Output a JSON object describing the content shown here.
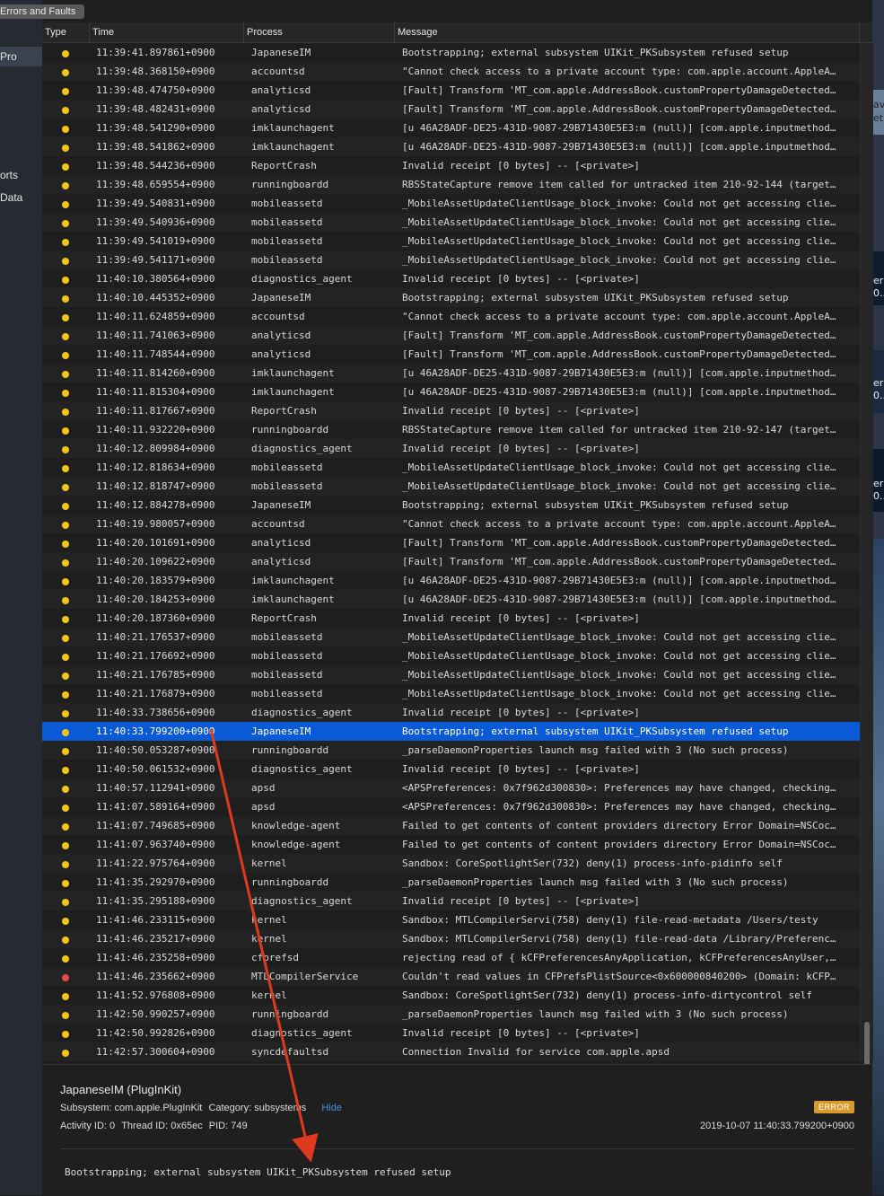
{
  "tab_chip": "Errors and Faults",
  "left_labels": [
    "Pro",
    "orts",
    "Data"
  ],
  "right_labels": [
    "ave",
    "et",
    "er",
    "0...",
    "er",
    "0...",
    "er",
    "0..."
  ],
  "columns": {
    "type": "Type",
    "time": "Time",
    "process": "Process",
    "message": "Message"
  },
  "colors": {
    "warning_dot": "#f2c618",
    "error_dot": "#e8474a",
    "selection": "#0a5ad6",
    "error_badge": "#d99a2b",
    "hide_link": "#4a90e2",
    "annotation_arrow": "#e03a1e"
  },
  "rows": [
    {
      "level": "warning",
      "time": "11:39:41.897861+0900",
      "process": "JapaneseIM",
      "message": "Bootstrapping; external subsystem UIKit_PKSubsystem refused setup"
    },
    {
      "level": "warning",
      "time": "11:39:48.368150+0900",
      "process": "accountsd",
      "message": "\"Cannot check access to a private account type: com.apple.account.AppleA…"
    },
    {
      "level": "warning",
      "time": "11:39:48.474750+0900",
      "process": "analyticsd",
      "message": "[Fault] Transform 'MT_com.apple.AddressBook.customPropertyDamageDetected…"
    },
    {
      "level": "warning",
      "time": "11:39:48.482431+0900",
      "process": "analyticsd",
      "message": "[Fault] Transform 'MT_com.apple.AddressBook.customPropertyDamageDetected…"
    },
    {
      "level": "warning",
      "time": "11:39:48.541290+0900",
      "process": "imklaunchagent",
      "message": "[u 46A28ADF-DE25-431D-9087-29B71430E5E3:m (null)] [com.apple.inputmethod…"
    },
    {
      "level": "warning",
      "time": "11:39:48.541862+0900",
      "process": "imklaunchagent",
      "message": "[u 46A28ADF-DE25-431D-9087-29B71430E5E3:m (null)] [com.apple.inputmethod…"
    },
    {
      "level": "warning",
      "time": "11:39:48.544236+0900",
      "process": "ReportCrash",
      "message": "Invalid receipt [0 bytes] -- [<private>]"
    },
    {
      "level": "warning",
      "time": "11:39:48.659554+0900",
      "process": "runningboardd",
      "message": "RBSStateCapture remove item called for untracked item 210-92-144 (target…"
    },
    {
      "level": "warning",
      "time": "11:39:49.540831+0900",
      "process": "mobileassetd",
      "message": "_MobileAssetUpdateClientUsage_block_invoke: Could not get accessing clie…"
    },
    {
      "level": "warning",
      "time": "11:39:49.540936+0900",
      "process": "mobileassetd",
      "message": "_MobileAssetUpdateClientUsage_block_invoke: Could not get accessing clie…"
    },
    {
      "level": "warning",
      "time": "11:39:49.541019+0900",
      "process": "mobileassetd",
      "message": "_MobileAssetUpdateClientUsage_block_invoke: Could not get accessing clie…"
    },
    {
      "level": "warning",
      "time": "11:39:49.541171+0900",
      "process": "mobileassetd",
      "message": "_MobileAssetUpdateClientUsage_block_invoke: Could not get accessing clie…"
    },
    {
      "level": "warning",
      "time": "11:40:10.380564+0900",
      "process": "diagnostics_agent",
      "message": "Invalid receipt [0 bytes] -- [<private>]"
    },
    {
      "level": "warning",
      "time": "11:40:10.445352+0900",
      "process": "JapaneseIM",
      "message": "Bootstrapping; external subsystem UIKit_PKSubsystem refused setup"
    },
    {
      "level": "warning",
      "time": "11:40:11.624859+0900",
      "process": "accountsd",
      "message": "\"Cannot check access to a private account type: com.apple.account.AppleA…"
    },
    {
      "level": "warning",
      "time": "11:40:11.741063+0900",
      "process": "analyticsd",
      "message": "[Fault] Transform 'MT_com.apple.AddressBook.customPropertyDamageDetected…"
    },
    {
      "level": "warning",
      "time": "11:40:11.748544+0900",
      "process": "analyticsd",
      "message": "[Fault] Transform 'MT_com.apple.AddressBook.customPropertyDamageDetected…"
    },
    {
      "level": "warning",
      "time": "11:40:11.814260+0900",
      "process": "imklaunchagent",
      "message": "[u 46A28ADF-DE25-431D-9087-29B71430E5E3:m (null)] [com.apple.inputmethod…"
    },
    {
      "level": "warning",
      "time": "11:40:11.815304+0900",
      "process": "imklaunchagent",
      "message": "[u 46A28ADF-DE25-431D-9087-29B71430E5E3:m (null)] [com.apple.inputmethod…"
    },
    {
      "level": "warning",
      "time": "11:40:11.817667+0900",
      "process": "ReportCrash",
      "message": "Invalid receipt [0 bytes] -- [<private>]"
    },
    {
      "level": "warning",
      "time": "11:40:11.932220+0900",
      "process": "runningboardd",
      "message": "RBSStateCapture remove item called for untracked item 210-92-147 (target…"
    },
    {
      "level": "warning",
      "time": "11:40:12.809984+0900",
      "process": "diagnostics_agent",
      "message": "Invalid receipt [0 bytes] -- [<private>]"
    },
    {
      "level": "warning",
      "time": "11:40:12.818634+0900",
      "process": "mobileassetd",
      "message": "_MobileAssetUpdateClientUsage_block_invoke: Could not get accessing clie…"
    },
    {
      "level": "warning",
      "time": "11:40:12.818747+0900",
      "process": "mobileassetd",
      "message": "_MobileAssetUpdateClientUsage_block_invoke: Could not get accessing clie…"
    },
    {
      "level": "warning",
      "time": "11:40:12.884278+0900",
      "process": "JapaneseIM",
      "message": "Bootstrapping; external subsystem UIKit_PKSubsystem refused setup"
    },
    {
      "level": "warning",
      "time": "11:40:19.980057+0900",
      "process": "accountsd",
      "message": "\"Cannot check access to a private account type: com.apple.account.AppleA…"
    },
    {
      "level": "warning",
      "time": "11:40:20.101691+0900",
      "process": "analyticsd",
      "message": "[Fault] Transform 'MT_com.apple.AddressBook.customPropertyDamageDetected…"
    },
    {
      "level": "warning",
      "time": "11:40:20.109622+0900",
      "process": "analyticsd",
      "message": "[Fault] Transform 'MT_com.apple.AddressBook.customPropertyDamageDetected…"
    },
    {
      "level": "warning",
      "time": "11:40:20.183579+0900",
      "process": "imklaunchagent",
      "message": "[u 46A28ADF-DE25-431D-9087-29B71430E5E3:m (null)] [com.apple.inputmethod…"
    },
    {
      "level": "warning",
      "time": "11:40:20.184253+0900",
      "process": "imklaunchagent",
      "message": "[u 46A28ADF-DE25-431D-9087-29B71430E5E3:m (null)] [com.apple.inputmethod…"
    },
    {
      "level": "warning",
      "time": "11:40:20.187360+0900",
      "process": "ReportCrash",
      "message": "Invalid receipt [0 bytes] -- [<private>]"
    },
    {
      "level": "warning",
      "time": "11:40:21.176537+0900",
      "process": "mobileassetd",
      "message": "_MobileAssetUpdateClientUsage_block_invoke: Could not get accessing clie…"
    },
    {
      "level": "warning",
      "time": "11:40:21.176692+0900",
      "process": "mobileassetd",
      "message": "_MobileAssetUpdateClientUsage_block_invoke: Could not get accessing clie…"
    },
    {
      "level": "warning",
      "time": "11:40:21.176785+0900",
      "process": "mobileassetd",
      "message": "_MobileAssetUpdateClientUsage_block_invoke: Could not get accessing clie…"
    },
    {
      "level": "warning",
      "time": "11:40:21.176879+0900",
      "process": "mobileassetd",
      "message": "_MobileAssetUpdateClientUsage_block_invoke: Could not get accessing clie…"
    },
    {
      "level": "warning",
      "time": "11:40:33.738656+0900",
      "process": "diagnostics_agent",
      "message": "Invalid receipt [0 bytes] -- [<private>]"
    },
    {
      "level": "warning",
      "time": "11:40:33.799200+0900",
      "process": "JapaneseIM",
      "message": "Bootstrapping; external subsystem UIKit_PKSubsystem refused setup",
      "selected": true
    },
    {
      "level": "warning",
      "time": "11:40:50.053287+0900",
      "process": "runningboardd",
      "message": "_parseDaemonProperties launch msg failed with 3 (No such process)"
    },
    {
      "level": "warning",
      "time": "11:40:50.061532+0900",
      "process": "diagnostics_agent",
      "message": "Invalid receipt [0 bytes] -- [<private>]"
    },
    {
      "level": "warning",
      "time": "11:40:57.112941+0900",
      "process": "apsd",
      "message": "<APSPreferences: 0x7f962d300830>: Preferences may have changed, checking…"
    },
    {
      "level": "warning",
      "time": "11:41:07.589164+0900",
      "process": "apsd",
      "message": "<APSPreferences: 0x7f962d300830>: Preferences may have changed, checking…"
    },
    {
      "level": "warning",
      "time": "11:41:07.749685+0900",
      "process": "knowledge-agent",
      "message": "Failed to get contents of content providers directory Error Domain=NSCoc…"
    },
    {
      "level": "warning",
      "time": "11:41:07.963740+0900",
      "process": "knowledge-agent",
      "message": "Failed to get contents of content providers directory Error Domain=NSCoc…"
    },
    {
      "level": "warning",
      "time": "11:41:22.975764+0900",
      "process": "kernel",
      "message": "Sandbox: CoreSpotlightSer(732) deny(1) process-info-pidinfo self"
    },
    {
      "level": "warning",
      "time": "11:41:35.292970+0900",
      "process": "runningboardd",
      "message": "_parseDaemonProperties launch msg failed with 3 (No such process)"
    },
    {
      "level": "warning",
      "time": "11:41:35.295188+0900",
      "process": "diagnostics_agent",
      "message": "Invalid receipt [0 bytes] -- [<private>]"
    },
    {
      "level": "warning",
      "time": "11:41:46.233115+0900",
      "process": "kernel",
      "message": "Sandbox: MTLCompilerServi(758) deny(1) file-read-metadata /Users/testy"
    },
    {
      "level": "warning",
      "time": "11:41:46.235217+0900",
      "process": "kernel",
      "message": "Sandbox: MTLCompilerServi(758) deny(1) file-read-data /Library/Preferenc…"
    },
    {
      "level": "warning",
      "time": "11:41:46.235258+0900",
      "process": "cfprefsd",
      "message": "rejecting read of { kCFPreferencesAnyApplication, kCFPreferencesAnyUser,…"
    },
    {
      "level": "error",
      "time": "11:41:46.235662+0900",
      "process": "MTLCompilerService",
      "message": "Couldn't read values in CFPrefsPlistSource<0x600000840200> (Domain: kCFP…"
    },
    {
      "level": "warning",
      "time": "11:41:52.976808+0900",
      "process": "kernel",
      "message": "Sandbox: CoreSpotlightSer(732) deny(1) process-info-dirtycontrol self"
    },
    {
      "level": "warning",
      "time": "11:42:50.990257+0900",
      "process": "runningboardd",
      "message": "_parseDaemonProperties launch msg failed with 3 (No such process)"
    },
    {
      "level": "warning",
      "time": "11:42:50.992826+0900",
      "process": "diagnostics_agent",
      "message": "Invalid receipt [0 bytes] -- [<private>]"
    },
    {
      "level": "warning",
      "time": "11:42:57.300604+0900",
      "process": "syncdefaultsd",
      "message": "Connection Invalid for service com.apple.apsd"
    }
  ],
  "detail": {
    "title": "JapaneseIM (PlugInKit)",
    "subsystem_label": "Subsystem:",
    "subsystem": "com.apple.PlugInKit",
    "category_label": "Category:",
    "category": "subsystems",
    "hide_label": "Hide",
    "activity_label": "Activity ID:",
    "activity": "0",
    "thread_label": "Thread ID:",
    "thread": "0x65ec",
    "pid_label": "PID:",
    "pid": "749",
    "badge": "ERROR",
    "timestamp": "2019-10-07 11:40:33.799200+0900",
    "message": "Bootstrapping; external subsystem UIKit_PKSubsystem refused setup"
  }
}
